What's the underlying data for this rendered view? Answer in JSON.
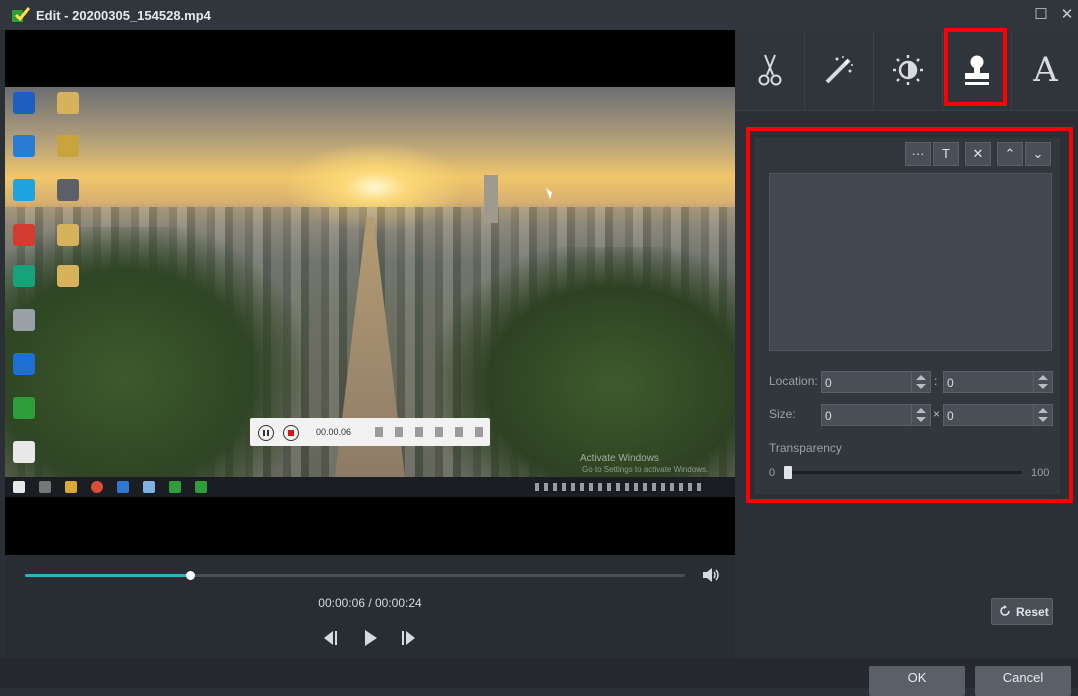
{
  "window": {
    "title": "Edit - 20200305_154528.mp4",
    "maximize_icon": "maximize-icon",
    "close_icon": "close-icon"
  },
  "preview": {
    "recorder_time": "00.00.06",
    "activate_title": "Activate Windows",
    "activate_sub": "Go to Settings to activate Windows.",
    "progress_fraction": 0.25,
    "time_display": "00:00:06 / 00:00:24"
  },
  "tabs": [
    {
      "name": "trim-tab",
      "icon": "scissors-icon"
    },
    {
      "name": "effects-tab",
      "icon": "magic-wand-icon"
    },
    {
      "name": "adjust-tab",
      "icon": "brightness-icon"
    },
    {
      "name": "watermark-tab",
      "icon": "stamp-icon",
      "active": true
    },
    {
      "name": "text-tab",
      "icon": "letter-a-icon",
      "glyph": "A"
    }
  ],
  "watermark": {
    "buttons": [
      "···",
      "T",
      "✕",
      "⌃",
      "⌄"
    ],
    "location_label": "Location:",
    "location_x": "0",
    "location_y": "0",
    "location_sep": ":",
    "size_label": "Size:",
    "size_w": "0",
    "size_h": "0",
    "size_sep": "×",
    "transparency_label": "Transparency",
    "transparency_min": "0",
    "transparency_max": "100",
    "transparency_value": 0
  },
  "reset_label": "Reset",
  "footer": {
    "ok_label": "OK",
    "cancel_label": "Cancel"
  },
  "colors": {
    "accent": "#2fb5bd",
    "highlight": "#ff0000"
  }
}
